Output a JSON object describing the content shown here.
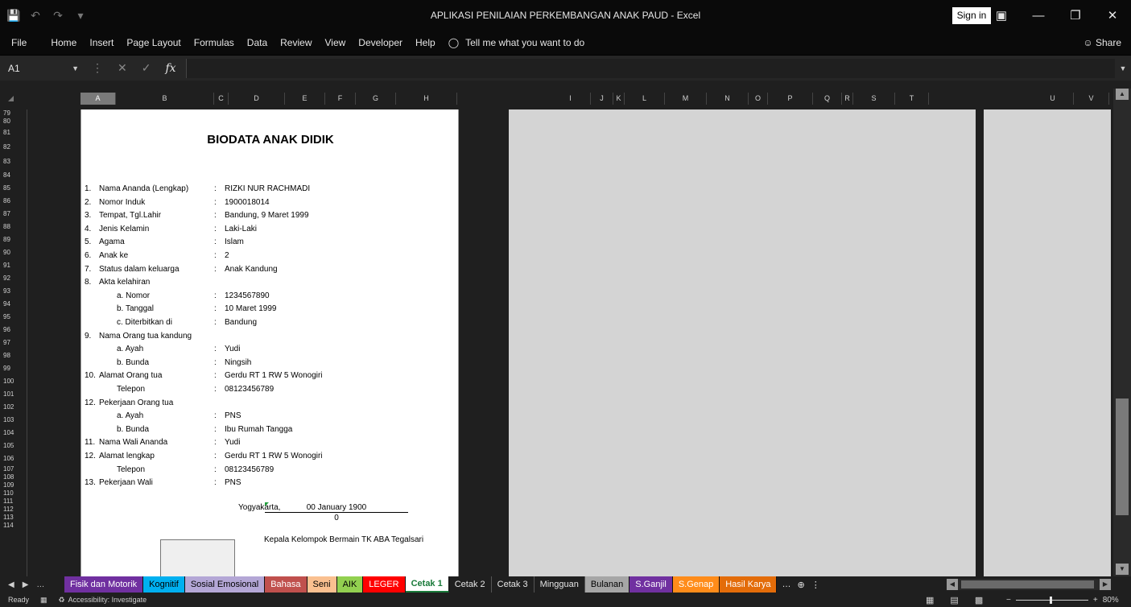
{
  "titlebar": {
    "title": "APLIKASI PENILAIAN PERKEMBANGAN ANAK PAUD  -  Excel",
    "sign_in": "Sign in",
    "qat_icons": [
      "save-icon",
      "undo-icon",
      "redo-icon",
      "customize-icon"
    ],
    "window_icons": [
      "ribbon-display-icon",
      "minimize-icon",
      "restore-icon",
      "close-icon"
    ]
  },
  "menu": {
    "items": [
      "File",
      "Home",
      "Insert",
      "Page Layout",
      "Formulas",
      "Data",
      "Review",
      "View",
      "Developer",
      "Help"
    ],
    "tell_me": "Tell me what you want to do",
    "share": "Share"
  },
  "formula_bar": {
    "name_box": "A1",
    "fx": "fx",
    "value": ""
  },
  "columns": [
    "A",
    "B",
    "C",
    "D",
    "E",
    "F",
    "G",
    "H",
    "I",
    "J",
    "K",
    "L",
    "M",
    "N",
    "O",
    "P",
    "Q",
    "R",
    "S",
    "T",
    "U",
    "V"
  ],
  "rows": [
    "79",
    "80",
    "81",
    "82",
    "83",
    "84",
    "85",
    "86",
    "87",
    "88",
    "89",
    "90",
    "91",
    "92",
    "93",
    "94",
    "95",
    "96",
    "97",
    "98",
    "99",
    "100",
    "101",
    "102",
    "103",
    "104",
    "105",
    "106",
    "107",
    "108",
    "109",
    "110",
    "111",
    "112",
    "113",
    "114"
  ],
  "document": {
    "title": "BIODATA ANAK DIDIK",
    "fields": [
      {
        "num": "1.",
        "label": "Nama Ananda (Lengkap)",
        "colon": ":",
        "value": "RIZKI NUR RACHMADI",
        "sub": false
      },
      {
        "num": "2.",
        "label": "Nomor Induk",
        "colon": ":",
        "value": "1900018014",
        "sub": false
      },
      {
        "num": "3.",
        "label": "Tempat, Tgl.Lahir",
        "colon": ":",
        "value": "Bandung, 9 Maret 1999",
        "sub": false
      },
      {
        "num": "4.",
        "label": "Jenis Kelamin",
        "colon": ":",
        "value": "Laki-Laki",
        "sub": false
      },
      {
        "num": "5.",
        "label": "Agama",
        "colon": ":",
        "value": "Islam",
        "sub": false
      },
      {
        "num": "6.",
        "label": "Anak ke",
        "colon": ":",
        "value": "2",
        "sub": false
      },
      {
        "num": "7.",
        "label": "Status dalam keluarga",
        "colon": ":",
        "value": "Anak Kandung",
        "sub": false
      },
      {
        "num": "8.",
        "label": "Akta kelahiran",
        "colon": "",
        "value": "",
        "sub": false
      },
      {
        "num": "",
        "label": "a.  Nomor",
        "colon": ":",
        "value": "1234567890",
        "sub": true
      },
      {
        "num": "",
        "label": "b.  Tanggal",
        "colon": ":",
        "value": "10 Maret 1999",
        "sub": true
      },
      {
        "num": "",
        "label": "c.  Diterbitkan di",
        "colon": ":",
        "value": "Bandung",
        "sub": true
      },
      {
        "num": "9.",
        "label": "Nama Orang tua kandung",
        "colon": "",
        "value": "",
        "sub": false
      },
      {
        "num": "",
        "label": "a.  Ayah",
        "colon": ":",
        "value": "Yudi",
        "sub": true
      },
      {
        "num": "",
        "label": "b.  Bunda",
        "colon": ":",
        "value": "Ningsih",
        "sub": true
      },
      {
        "num": "10.",
        "label": "Alamat Orang tua",
        "colon": ":",
        "value": "Gerdu RT 1 RW 5 Wonogiri",
        "sub": false
      },
      {
        "num": "",
        "label": "Telepon",
        "colon": ":",
        "value": "08123456789",
        "sub": true
      },
      {
        "num": "12.",
        "label": "Pekerjaan Orang tua",
        "colon": "",
        "value": "",
        "sub": false
      },
      {
        "num": "",
        "label": "a.  Ayah",
        "colon": ":",
        "value": "PNS",
        "sub": true
      },
      {
        "num": "",
        "label": "b.  Bunda",
        "colon": ":",
        "value": "Ibu Rumah Tangga",
        "sub": true
      },
      {
        "num": "11.",
        "label": "Nama Wali Ananda",
        "colon": ":",
        "value": "Yudi",
        "sub": false
      },
      {
        "num": "12.",
        "label": "Alamat lengkap",
        "colon": ":",
        "value": "Gerdu RT 1 RW 5 Wonogiri",
        "sub": false
      },
      {
        "num": "",
        "label": "Telepon",
        "colon": ":",
        "value": "08123456789",
        "sub": true
      },
      {
        "num": "13.",
        "label": "Pekerjaan Wali",
        "colon": ":",
        "value": "PNS",
        "sub": false
      }
    ],
    "place": "Yogyakarta,",
    "date": "00 January 1900",
    "date_zero": "0",
    "signature_caption": "Kepala Kelompok Bermain TK ABA Tegalsari"
  },
  "sheet_tabs": [
    {
      "label": "Fisik dan Motorik",
      "color": "#7030a0",
      "text_color": "#ffffff"
    },
    {
      "label": "Kognitif",
      "color": "#00b0f0",
      "text_color": "#000000"
    },
    {
      "label": "Sosial Emosional",
      "color": "#b4a7d6",
      "text_color": "#000000"
    },
    {
      "label": "Bahasa",
      "color": "#c0504d",
      "text_color": "#ffffff"
    },
    {
      "label": "Seni",
      "color": "#fac090",
      "text_color": "#000000"
    },
    {
      "label": "AIK",
      "color": "#92d050",
      "text_color": "#000000"
    },
    {
      "label": "LEGER",
      "color": "#ff0000",
      "text_color": "#ffffff"
    },
    {
      "label": "Cetak 1",
      "color": "#ffffff",
      "text_color": "#1a7a3a",
      "active": true
    },
    {
      "label": "Cetak 2",
      "color": "",
      "text_color": "#e6e6e6"
    },
    {
      "label": "Cetak 3",
      "color": "",
      "text_color": "#e6e6e6"
    },
    {
      "label": "Mingguan",
      "color": "",
      "text_color": "#e6e6e6"
    },
    {
      "label": "Bulanan",
      "color": "#a6a6a6",
      "text_color": "#000000"
    },
    {
      "label": "S.Ganjil",
      "color": "#7030a0",
      "text_color": "#ffffff"
    },
    {
      "label": "S.Genap",
      "color": "#ff8c1a",
      "text_color": "#ffffff"
    },
    {
      "label": "Hasil Karya",
      "color": "#e36c09",
      "text_color": "#ffffff"
    }
  ],
  "status": {
    "ready": "Ready",
    "accessibility": "Accessibility: Investigate",
    "zoom": "80%"
  }
}
